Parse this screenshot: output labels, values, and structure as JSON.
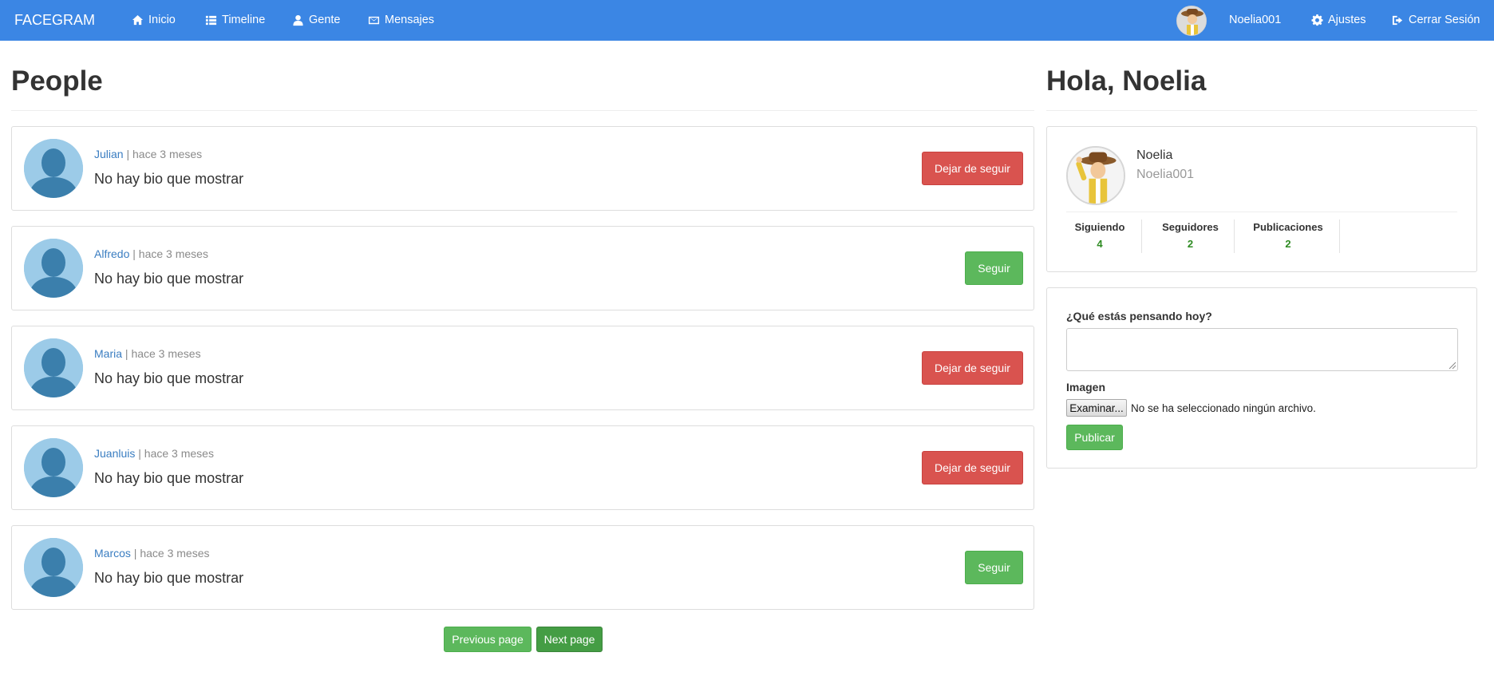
{
  "navbar": {
    "brand": "FACEGRAM",
    "links": [
      {
        "label": "Inicio",
        "icon": "home-icon"
      },
      {
        "label": "Timeline",
        "icon": "list-icon"
      },
      {
        "label": "Gente",
        "icon": "user-icon"
      },
      {
        "label": "Mensajes",
        "icon": "envelope-icon"
      }
    ],
    "username": "Noelia001",
    "settings_label": "Ajustes",
    "logout_label": "Cerrar Sesión"
  },
  "people": {
    "title": "People",
    "time_sep": " | ",
    "items": [
      {
        "name": "Julian",
        "time": "hace 3 meses",
        "bio": "No hay bio que mostrar",
        "action": "Dejar de seguir",
        "following": true
      },
      {
        "name": "Alfredo",
        "time": "hace 3 meses",
        "bio": "No hay bio que mostrar",
        "action": "Seguir",
        "following": false
      },
      {
        "name": "Maria",
        "time": "hace 3 meses",
        "bio": "No hay bio que mostrar",
        "action": "Dejar de seguir",
        "following": true
      },
      {
        "name": "Juanluis",
        "time": "hace 3 meses",
        "bio": "No hay bio que mostrar",
        "action": "Dejar de seguir",
        "following": true
      },
      {
        "name": "Marcos",
        "time": "hace 3 meses",
        "bio": "No hay bio que mostrar",
        "action": "Seguir",
        "following": false
      }
    ],
    "pagination": {
      "prev": "Previous page",
      "next": "Next page"
    }
  },
  "sidebar": {
    "greeting": "Hola, Noelia",
    "profile": {
      "name": "Noelia",
      "username": "Noelia001",
      "stats": [
        {
          "label": "Siguiendo",
          "value": "4"
        },
        {
          "label": "Seguidores",
          "value": "2"
        },
        {
          "label": "Publicaciones",
          "value": "2"
        }
      ]
    },
    "post_form": {
      "prompt_label": "¿Qué estás pensando hoy?",
      "text_value": "",
      "image_label": "Imagen",
      "file_button": "Examinar...",
      "file_status": "No se ha seleccionado ningún archivo.",
      "submit": "Publicar"
    }
  },
  "colors": {
    "navbar": "#3b86e4",
    "follow_green": "#5cb85c",
    "unfollow_red": "#d9534f",
    "link_blue": "#3a7dc1",
    "stat_green": "#2e8b22"
  }
}
